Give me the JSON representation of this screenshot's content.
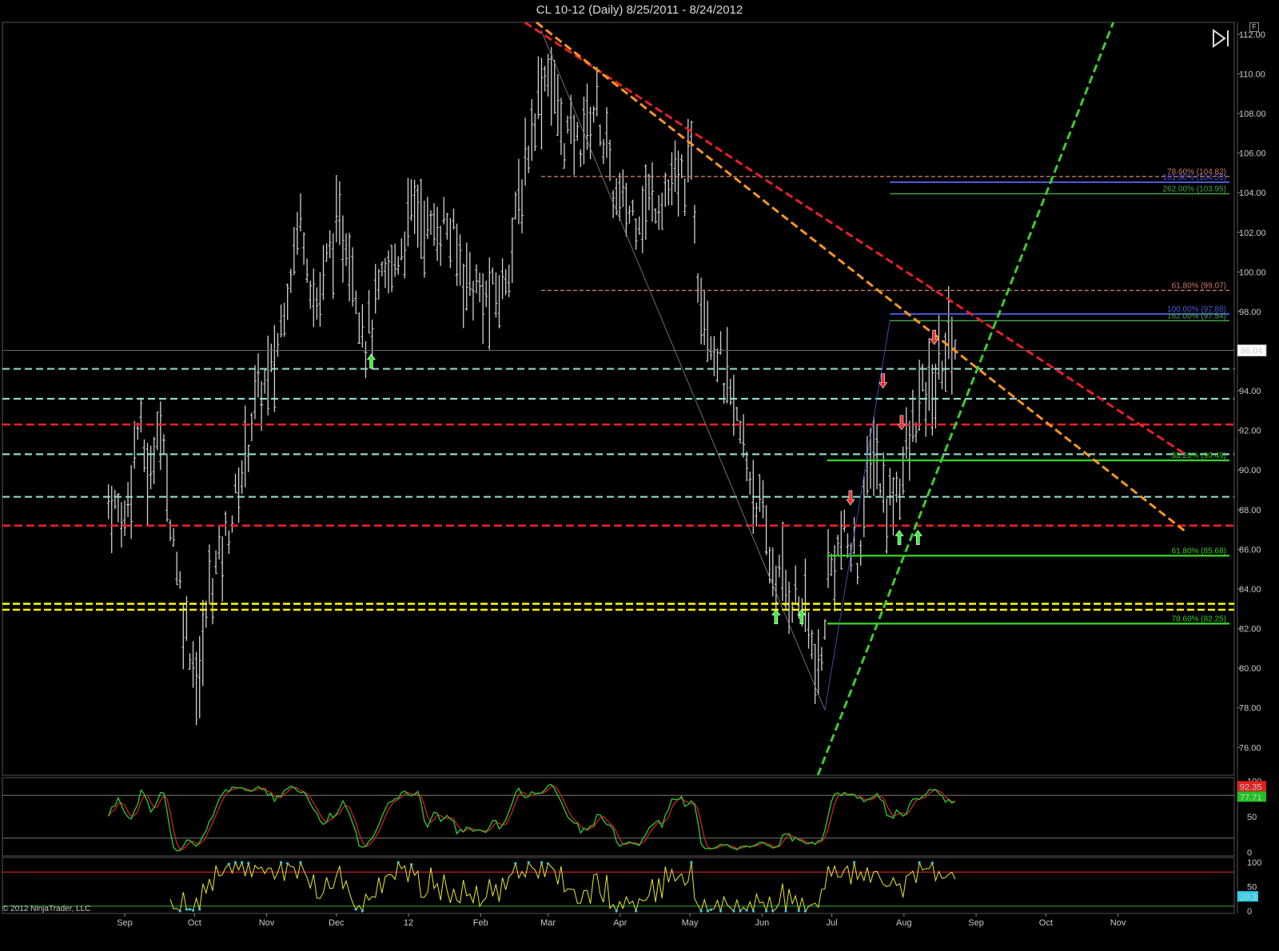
{
  "window": {
    "title": "CL 10-12 (Daily)  8/25/2011 - 8/24/2012",
    "copyright": "© 2012 NinjaTrader, LLC",
    "corner_button_label": "F"
  },
  "icons": {
    "end_button": "play-end-icon"
  },
  "colors": {
    "background": "#000000",
    "bars": "#d0d0d0",
    "resistance_dash": "#e8202a",
    "support_teal": "#8fd8c8",
    "support_yellow": "#f5f500",
    "trend_orange": "#f5961e",
    "trend_green": "#3ccc2c",
    "stoch_fast": "#2fbf2f",
    "stoch_slow": "#c02020",
    "indicator_yellow": "#e8e830",
    "indicator_cyan": "#30d0e8"
  },
  "chart_data": [
    {
      "type": "ohlc",
      "title": "CL 10-12 (Daily)  8/25/2011 - 8/24/2012",
      "x_tick_labels": [
        "Sep",
        "Oct",
        "Nov",
        "Dec",
        "12",
        "Feb",
        "Mar",
        "Apr",
        "May",
        "Jun",
        "Jul",
        "Aug",
        "Sep",
        "Oct",
        "Nov"
      ],
      "y_tick_labels": [
        "76.00",
        "78.00",
        "80.00",
        "82.00",
        "84.00",
        "86.00",
        "88.00",
        "90.00",
        "92.00",
        "94.00",
        "96.00",
        "98.00",
        "100.00",
        "102.00",
        "104.00",
        "106.00",
        "108.00",
        "110.00",
        "112.00"
      ],
      "ylim": [
        74.6,
        112.6
      ],
      "last_price": "96.04",
      "grid": false,
      "price_path": [
        [
          "2011-08-25",
          88.5
        ],
        [
          "2011-09-01",
          87.5
        ],
        [
          "2011-09-07",
          92.5
        ],
        [
          "2011-09-12",
          89.0
        ],
        [
          "2011-09-15",
          93.0
        ],
        [
          "2011-09-20",
          88.5
        ],
        [
          "2011-09-26",
          83.0
        ],
        [
          "2011-10-03",
          79.0
        ],
        [
          "2011-10-07",
          84.0
        ],
        [
          "2011-10-13",
          86.0
        ],
        [
          "2011-10-20",
          89.0
        ],
        [
          "2011-10-27",
          93.5
        ],
        [
          "2011-11-04",
          95.0
        ],
        [
          "2011-11-10",
          99.5
        ],
        [
          "2011-11-16",
          103.0
        ],
        [
          "2011-11-22",
          98.0
        ],
        [
          "2011-11-29",
          101.5
        ],
        [
          "2011-12-05",
          102.0
        ],
        [
          "2011-12-14",
          96.5
        ],
        [
          "2011-12-20",
          99.0
        ],
        [
          "2011-12-28",
          101.0
        ],
        [
          "2012-01-04",
          103.5
        ],
        [
          "2012-01-10",
          102.0
        ],
        [
          "2012-01-17",
          102.5
        ],
        [
          "2012-01-25",
          100.0
        ],
        [
          "2012-02-03",
          98.5
        ],
        [
          "2012-02-10",
          99.0
        ],
        [
          "2012-02-17",
          103.0
        ],
        [
          "2012-02-24",
          108.0
        ],
        [
          "2012-03-01",
          110.5
        ],
        [
          "2012-03-07",
          107.0
        ],
        [
          "2012-03-14",
          106.5
        ],
        [
          "2012-03-22",
          108.5
        ],
        [
          "2012-03-30",
          103.5
        ],
        [
          "2012-04-06",
          103.0
        ],
        [
          "2012-04-13",
          103.5
        ],
        [
          "2012-04-20",
          104.0
        ],
        [
          "2012-04-27",
          104.5
        ],
        [
          "2012-05-02",
          105.5
        ],
        [
          "2012-05-04",
          100.5
        ],
        [
          "2012-05-09",
          97.5
        ],
        [
          "2012-05-16",
          94.5
        ],
        [
          "2012-05-23",
          91.5
        ],
        [
          "2012-05-31",
          88.0
        ],
        [
          "2012-06-05",
          85.0
        ],
        [
          "2012-06-12",
          84.0
        ],
        [
          "2012-06-19",
          83.0
        ],
        [
          "2012-06-26",
          79.0
        ],
        [
          "2012-06-29",
          84.5
        ],
        [
          "2012-07-05",
          86.5
        ],
        [
          "2012-07-12",
          85.5
        ],
        [
          "2012-07-19",
          91.5
        ],
        [
          "2012-07-24",
          88.0
        ],
        [
          "2012-07-30",
          89.5
        ],
        [
          "2012-08-03",
          91.0
        ],
        [
          "2012-08-08",
          93.5
        ],
        [
          "2012-08-14",
          94.0
        ],
        [
          "2012-08-21",
          97.0
        ],
        [
          "2012-08-24",
          96.04
        ]
      ],
      "horizontal_levels": [
        {
          "price": 95.11,
          "style": "teal-dashed"
        },
        {
          "price": 93.6,
          "style": "teal-dashed"
        },
        {
          "price": 92.3,
          "style": "red-dashed"
        },
        {
          "price": 90.8,
          "style": "teal-dashed"
        },
        {
          "price": 88.65,
          "style": "teal-dashed"
        },
        {
          "price": 87.2,
          "style": "red-dashed"
        },
        {
          "price": 83.25,
          "style": "yellow-dashed"
        },
        {
          "price": 82.95,
          "style": "yellow-dashed"
        }
      ],
      "fib_levels": [
        {
          "label": "78.60% (104.82)",
          "price": 104.82,
          "color": "#c87a6a"
        },
        {
          "label": "161.80% (104.53)",
          "price": 104.53,
          "color": "#4a5ad8"
        },
        {
          "label": "262.00% (103.95)",
          "price": 103.95,
          "color": "#4aa84a"
        },
        {
          "label": "61.80% (99.07)",
          "price": 99.07,
          "color": "#c87a6a"
        },
        {
          "label": "100.00% (97.88)",
          "price": 97.88,
          "color": "#4a5ad8"
        },
        {
          "label": "162.00% (97.54)",
          "price": 97.54,
          "color": "#4aa84a"
        },
        {
          "label": "38.20% (90.49)",
          "price": 90.49,
          "color": "#3ccc2c"
        },
        {
          "label": "61.80% (85.68)",
          "price": 85.68,
          "color": "#3ccc2c"
        },
        {
          "label": "78.60% (82.25)",
          "price": 82.25,
          "color": "#3ccc2c"
        }
      ],
      "trend_lines": [
        {
          "from": [
            "2012-02-20",
            112.6
          ],
          "to": [
            "2012-11-30",
            90.8
          ],
          "style": "red-dashed"
        },
        {
          "from": [
            "2012-02-25",
            112.6
          ],
          "to": [
            "2012-11-30",
            86.9
          ],
          "style": "orange-dashed"
        },
        {
          "from": [
            "2012-06-25",
            74.6
          ],
          "to": [
            "2012-10-30",
            112.6
          ],
          "style": "green-dashed"
        },
        {
          "from": [
            "2012-02-27",
            112.2
          ],
          "to": [
            "2012-06-28",
            77.9
          ],
          "style": "gray-thin"
        },
        {
          "from": [
            "2012-06-28",
            77.9
          ],
          "to": [
            "2012-07-26",
            97.6
          ],
          "style": "blue-thin"
        }
      ],
      "signals": [
        {
          "date": "2011-12-16",
          "price": 95.5,
          "dir": "up"
        },
        {
          "date": "2012-06-07",
          "price": 82.6,
          "dir": "up"
        },
        {
          "date": "2012-06-18",
          "price": 82.6,
          "dir": "up"
        },
        {
          "date": "2012-07-09",
          "price": 88.6,
          "dir": "down"
        },
        {
          "date": "2012-07-23",
          "price": 94.5,
          "dir": "down"
        },
        {
          "date": "2012-07-31",
          "price": 92.4,
          "dir": "down"
        },
        {
          "date": "2012-07-30",
          "price": 86.6,
          "dir": "up"
        },
        {
          "date": "2012-08-07",
          "price": 86.6,
          "dir": "up"
        },
        {
          "date": "2012-08-14",
          "price": 96.7,
          "dir": "down"
        }
      ]
    },
    {
      "type": "line",
      "name": "stochastics",
      "y_tick_labels": [
        "0",
        "50",
        "100"
      ],
      "ylim": [
        -5,
        105
      ],
      "reference_lines": [
        80,
        20
      ],
      "last_values": [
        "92.35",
        "77.71"
      ],
      "series": [
        {
          "values_at_path": "k"
        },
        {
          "values_at_path": "d"
        }
      ]
    },
    {
      "type": "line",
      "name": "oscillator",
      "y_tick_labels": [
        "0",
        "50",
        "100"
      ],
      "ylim": [
        -5,
        110
      ],
      "reference_lines": [
        80,
        10
      ],
      "last_value": "29.3"
    }
  ]
}
